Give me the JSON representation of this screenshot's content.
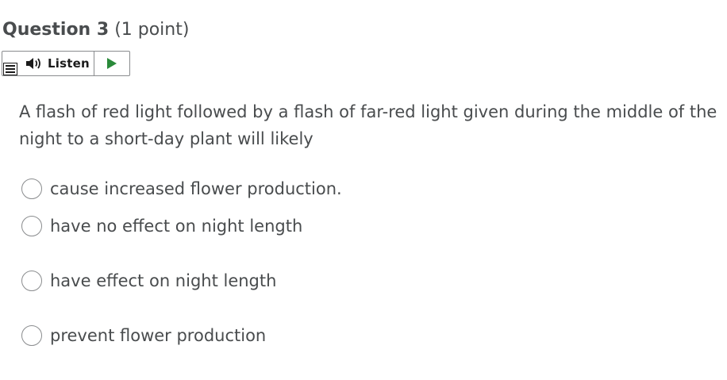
{
  "question": {
    "label": "Question 3",
    "points": "(1 point)"
  },
  "listen_widget": {
    "menu_icon": "menu-icon",
    "speaker_icon": "speaker-icon",
    "label": "Listen",
    "play_icon": "play-icon",
    "play_color": "#2a8a3a"
  },
  "prompt": "A flash of red light followed by a flash of far-red light given during the middle of the night to a short-day plant will likely",
  "options": [
    {
      "label": "cause increased flower production."
    },
    {
      "label": "have no effect on night length"
    },
    {
      "label": "have effect on night length"
    },
    {
      "label": "prevent flower production"
    }
  ]
}
